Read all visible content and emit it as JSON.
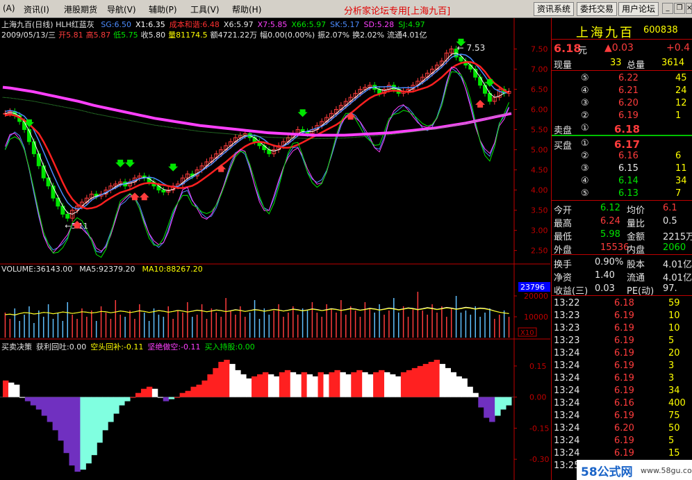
{
  "menu": {
    "items": [
      "(A)",
      "资讯(I)",
      "港股期货",
      "导航(V)",
      "辅助(P)",
      "工具(V)",
      "帮助(H)"
    ],
    "brand_title": "分析家论坛专用[上海九百]",
    "buttons": [
      "资讯系统",
      "委托交易",
      "用户论坛"
    ],
    "window_controls": [
      "minimize-icon",
      "restore-icon",
      "close-icon"
    ]
  },
  "main_chart": {
    "header": "上海九百(日线) HLH红蓝灰",
    "indicators": [
      {
        "text": "SG:6.50",
        "color": "#4c8cff"
      },
      {
        "text": "X1:6.35",
        "color": "#ffffff"
      },
      {
        "text": "成本和谐:6.48",
        "color": "#ff3030"
      },
      {
        "text": "X6:5.97",
        "color": "#e6e6e6"
      },
      {
        "text": "X7:5.85",
        "color": "#ff40ff"
      },
      {
        "text": "X66:5.97",
        "color": "#00e600"
      },
      {
        "text": "SK:5.17",
        "color": "#4c8cff"
      },
      {
        "text": "SD:5.28",
        "color": "#ff40ff"
      },
      {
        "text": "SJ:4.97",
        "color": "#00e600"
      }
    ],
    "ohlc_line": [
      {
        "text": "2009/05/13/三",
        "color": "#e6e6e6"
      },
      {
        "text": "开5.81",
        "color": "#ff3c3c"
      },
      {
        "text": "高5.87",
        "color": "#ff3c3c"
      },
      {
        "text": "低5.75",
        "color": "#00e600"
      },
      {
        "text": "收5.80",
        "color": "#e6e6e6"
      },
      {
        "text": "量81174.5",
        "color": "#ffff00"
      },
      {
        "text": "额4721.22万",
        "color": "#e6e6e6"
      },
      {
        "text": "幅0.00(0.00%)",
        "color": "#e6e6e6"
      },
      {
        "text": "振2.07%",
        "color": "#e6e6e6"
      },
      {
        "text": "换2.02%",
        "color": "#e6e6e6"
      },
      {
        "text": "流通4.01亿",
        "color": "#e6e6e6"
      }
    ],
    "high_marker": "7.53",
    "low_marker": "3.11"
  },
  "volume_chart": {
    "indicators": [
      {
        "text": "VOLUME:36143.00",
        "color": "#e6e6e6"
      },
      {
        "text": "MA5:92379.20",
        "color": "#e6e6e6"
      },
      {
        "text": "MA10:88267.20",
        "color": "#ffff00"
      }
    ],
    "current_tag": "23796",
    "unit_tag": "X10"
  },
  "decision_chart": {
    "indicators": [
      {
        "text": "买卖决策",
        "color": "#e6e6e6"
      },
      {
        "text": "获利回吐:0.00",
        "color": "#e6e6e6"
      },
      {
        "text": "空头回补:-0.11",
        "color": "#ffff00"
      },
      {
        "text": "坚绝做空:-0.11",
        "color": "#ff40ff"
      },
      {
        "text": "买入持股:0.00",
        "color": "#00e600"
      }
    ]
  },
  "chart_data": [
    {
      "type": "candlestick",
      "title": "上海九百(日线) HLH红蓝灰",
      "y_ticks": [
        7.5,
        7.0,
        6.5,
        6.0,
        5.5,
        5.0,
        4.5,
        4.0,
        3.5,
        3.0,
        2.5
      ],
      "ylim": [
        2.2,
        7.75
      ],
      "close_series": [
        5.9,
        5.95,
        5.85,
        5.7,
        5.5,
        5.2,
        4.9,
        4.6,
        4.3,
        4.1,
        3.8,
        3.6,
        3.4,
        3.3,
        3.5,
        3.6,
        3.7,
        3.8,
        3.9,
        3.85,
        3.9,
        4.0,
        4.1,
        4.15,
        4.2,
        4.1,
        4.2,
        4.3,
        4.35,
        4.3,
        4.2,
        4.1,
        4.0,
        3.95,
        4.0,
        4.1,
        4.15,
        4.3,
        4.4,
        4.35,
        4.5,
        4.6,
        4.7,
        4.8,
        4.9,
        5.0,
        5.1,
        5.2,
        5.3,
        5.35,
        5.4,
        5.3,
        5.2,
        5.1,
        5.0,
        4.9,
        5.0,
        5.1,
        5.2,
        5.3,
        5.4,
        5.5,
        5.45,
        5.4,
        5.5,
        5.6,
        5.7,
        5.8,
        5.9,
        6.0,
        6.1,
        6.2,
        6.3,
        6.4,
        6.5,
        6.55,
        6.6,
        6.5,
        6.4,
        6.5,
        6.6,
        6.5,
        6.4,
        6.45,
        6.5,
        6.6,
        6.7,
        6.8,
        6.9,
        7.0,
        7.1,
        7.2,
        7.4,
        7.5,
        7.3,
        7.2,
        7.1,
        7.0,
        6.8,
        6.6,
        6.4,
        6.2,
        6.3,
        6.5,
        6.4,
        6.45
      ],
      "ma_long_series": [
        6.55,
        6.53,
        6.5,
        6.47,
        6.44,
        6.4,
        6.36,
        6.32,
        6.28,
        6.24,
        6.2,
        6.15,
        6.1,
        6.06,
        6.02,
        5.98,
        5.94,
        5.9,
        5.86,
        5.82,
        5.78,
        5.75,
        5.72,
        5.69,
        5.66,
        5.63,
        5.6,
        5.58,
        5.56,
        5.54,
        5.52,
        5.5,
        5.48,
        5.46,
        5.44,
        5.42,
        5.41,
        5.4,
        5.39,
        5.38,
        5.37,
        5.36,
        5.36,
        5.36,
        5.36,
        5.36,
        5.37,
        5.38,
        5.39,
        5.4,
        5.41,
        5.42,
        5.44,
        5.46,
        5.48,
        5.5,
        5.52,
        5.54,
        5.57,
        5.6,
        5.63,
        5.66,
        5.7,
        5.74,
        5.78,
        5.82,
        5.86,
        5.9
      ],
      "low_marker": {
        "value": 3.11,
        "label": "3.11"
      },
      "high_marker": {
        "value": 7.53,
        "label": "7.53"
      }
    },
    {
      "type": "bar",
      "title": "VOLUME",
      "y_ticks": [
        20000,
        10000
      ],
      "y_tick_labels": [
        "20000",
        "10000"
      ],
      "ylim": [
        0,
        30000
      ],
      "values": [
        12000,
        9000,
        14000,
        8000,
        11000,
        15000,
        7000,
        13000,
        10000,
        16000,
        9000,
        12000,
        8000,
        17000,
        11000,
        9000,
        14000,
        10000,
        13000,
        8000,
        15000,
        12000,
        9000,
        18000,
        11000,
        10000,
        13000,
        9000,
        16000,
        12000,
        8000,
        14000,
        11000,
        10000,
        15000,
        9000,
        13000,
        12000,
        17000,
        10000,
        11000,
        16000,
        9000,
        14000,
        12000,
        10000,
        19000,
        13000,
        11000,
        15000,
        10000,
        12000,
        18000,
        9000,
        14000,
        11000,
        13000,
        16000,
        10000,
        12000,
        15000,
        11000,
        14000,
        13000,
        17000,
        12000,
        10000,
        16000,
        14000,
        12000,
        18000,
        11000,
        15000,
        13000,
        10000,
        17000,
        14000,
        12000,
        16000,
        11000,
        13000,
        19000,
        12000,
        15000,
        10000,
        14000,
        22000,
        13000,
        11000,
        16000,
        12000,
        15000,
        10000,
        14000,
        20000,
        12000,
        13000,
        11000,
        15000,
        10000,
        12000,
        14000,
        9000,
        11000,
        13000,
        10000
      ],
      "ma5": [
        11000,
        11200,
        10800,
        11500,
        12000,
        11800,
        11300,
        11600,
        12100,
        11900,
        11400,
        11800,
        12300,
        12000,
        11600,
        11900,
        12400,
        12200,
        11800,
        12100,
        12600,
        12400,
        11900,
        12300,
        12800,
        12500,
        12000,
        12400,
        12900,
        12600,
        12100,
        12500,
        13000,
        12700,
        12200,
        12600,
        13100,
        12800,
        12300,
        12700,
        13200,
        12900,
        12400,
        12800,
        13300,
        13000,
        12500,
        12900,
        13400,
        13100,
        12600,
        13000,
        13500,
        13200,
        12700,
        13100,
        13600,
        13300,
        12800,
        13200,
        13700,
        13400,
        12900,
        13300,
        13800,
        13500,
        13000,
        13400,
        13900,
        13600,
        13100,
        13500,
        14000,
        13700,
        13200,
        13600,
        14100,
        13800,
        13300,
        13700,
        14200,
        13900,
        13400,
        13800,
        14300,
        14000,
        13500,
        13900,
        14400,
        14100,
        13600,
        14000,
        14500,
        14200,
        13700,
        14100,
        14600,
        14300,
        13800,
        14200,
        14000,
        13500,
        12800,
        12200,
        11800,
        11500
      ]
    },
    {
      "type": "bar",
      "title": "买卖决策",
      "y_ticks": [
        0.15,
        0.0,
        -0.15,
        -0.3
      ],
      "y_tick_labels": [
        "0.15",
        "0.00",
        "-0.15",
        "-0.30"
      ],
      "ylim": [
        -0.4,
        0.22
      ],
      "values": [
        0.08,
        0.07,
        0.06,
        0.0,
        -0.02,
        -0.04,
        -0.06,
        -0.09,
        -0.12,
        -0.16,
        -0.21,
        -0.27,
        -0.33,
        -0.36,
        -0.35,
        -0.32,
        -0.28,
        -0.22,
        -0.16,
        -0.12,
        -0.08,
        -0.04,
        -0.02,
        0.0,
        0.02,
        0.04,
        0.05,
        0.04,
        0.0,
        -0.02,
        -0.01,
        0.0,
        0.02,
        0.03,
        0.05,
        0.06,
        0.08,
        0.11,
        0.14,
        0.17,
        0.18,
        0.16,
        0.13,
        0.11,
        0.09,
        0.1,
        0.11,
        0.12,
        0.11,
        0.1,
        0.12,
        0.13,
        0.12,
        0.11,
        0.12,
        0.11,
        0.1,
        0.12,
        0.11,
        0.12,
        0.13,
        0.12,
        0.11,
        0.12,
        0.13,
        0.12,
        0.11,
        0.12,
        0.13,
        0.12,
        0.11,
        0.1,
        0.12,
        0.13,
        0.14,
        0.15,
        0.16,
        0.17,
        0.18,
        0.16,
        0.14,
        0.12,
        0.1,
        0.09,
        0.05,
        0.02,
        -0.05,
        -0.1,
        -0.12,
        -0.09,
        -0.06,
        -0.04
      ]
    }
  ],
  "right_panel": {
    "stock_name": "上海九百",
    "stock_code": "600838",
    "price": "6.18",
    "price_unit": "元",
    "change": "▲0.03",
    "change_pct": "+0.4",
    "current_vol_label": "现量",
    "current_vol": "33",
    "total_vol_label": "总量",
    "total_vol": "3614",
    "sell_label": "卖盘",
    "buy_label": "买盘",
    "asks": [
      {
        "level": "⑤",
        "price": "6.22",
        "vol": "45",
        "price_color": "red"
      },
      {
        "level": "④",
        "price": "6.21",
        "vol": "24",
        "price_color": "red"
      },
      {
        "level": "③",
        "price": "6.20",
        "vol": "12",
        "price_color": "red"
      },
      {
        "level": "②",
        "price": "6.19",
        "vol": "1",
        "price_color": "red"
      },
      {
        "level": "①",
        "price": "6.18",
        "vol": "",
        "price_color": "red"
      }
    ],
    "bids": [
      {
        "level": "①",
        "price": "6.17",
        "vol": "",
        "price_color": "red"
      },
      {
        "level": "②",
        "price": "6.16",
        "vol": "6",
        "price_color": "red"
      },
      {
        "level": "③",
        "price": "6.15",
        "vol": "11",
        "price_color": "white"
      },
      {
        "level": "④",
        "price": "6.14",
        "vol": "34",
        "price_color": "green"
      },
      {
        "level": "⑤",
        "price": "6.13",
        "vol": "7",
        "price_color": "green"
      }
    ],
    "stats": [
      {
        "l1": "今开",
        "v1": "6.12",
        "c1": "green",
        "l2": "均价",
        "v2": "6.1",
        "c2": "red"
      },
      {
        "l1": "最高",
        "v1": "6.24",
        "c1": "red",
        "l2": "量比",
        "v2": "0.5",
        "c2": "white"
      },
      {
        "l1": "最低",
        "v1": "5.98",
        "c1": "green",
        "l2": "金额",
        "v2": "2215万",
        "c2": "white"
      },
      {
        "l1": "外盘",
        "v1": "15536",
        "c1": "red",
        "l2": "内盘",
        "v2": "2060",
        "c2": "green"
      }
    ],
    "stats2": [
      {
        "l1": "换手",
        "v1": "0.90%",
        "c1": "white",
        "l2": "股本",
        "v2": "4.01亿",
        "c2": "white"
      },
      {
        "l1": "净资",
        "v1": "1.40",
        "c1": "white",
        "l2": "流通",
        "v2": "4.01亿",
        "c2": "white"
      },
      {
        "l1": "收益(三)",
        "v1": "0.03",
        "c1": "white",
        "l2": "PE(动)",
        "v2": "97.",
        "c2": "white"
      }
    ],
    "ticks": [
      {
        "time": "13:22",
        "price": "6.18",
        "vol": "59"
      },
      {
        "time": "13:23",
        "price": "6.19",
        "vol": "10"
      },
      {
        "time": "13:23",
        "price": "6.19",
        "vol": "10"
      },
      {
        "time": "13:23",
        "price": "6.19",
        "vol": "5"
      },
      {
        "time": "13:24",
        "price": "6.19",
        "vol": "20"
      },
      {
        "time": "13:24",
        "price": "6.19",
        "vol": "3"
      },
      {
        "time": "13:24",
        "price": "6.19",
        "vol": "3"
      },
      {
        "time": "13:24",
        "price": "6.19",
        "vol": "34"
      },
      {
        "time": "13:24",
        "price": "6.16",
        "vol": "400"
      },
      {
        "time": "13:24",
        "price": "6.19",
        "vol": "75"
      },
      {
        "time": "13:24",
        "price": "6.20",
        "vol": "50"
      },
      {
        "time": "13:24",
        "price": "6.19",
        "vol": "5"
      },
      {
        "time": "13:24",
        "price": "6.19",
        "vol": "15"
      },
      {
        "time": "13:25",
        "price": "6.19",
        "vol": ""
      }
    ]
  },
  "watermark": {
    "brand": "58公式网",
    "site": "www.58gu.com"
  },
  "colors": {
    "up": "#ff3c3c",
    "down": "#00e600",
    "ma_pink": "#ff40ff",
    "ma_blue": "#4c8cff",
    "frame": "#c00000",
    "purple": "#7030c0",
    "cyan_bar": "#80ffe0"
  }
}
